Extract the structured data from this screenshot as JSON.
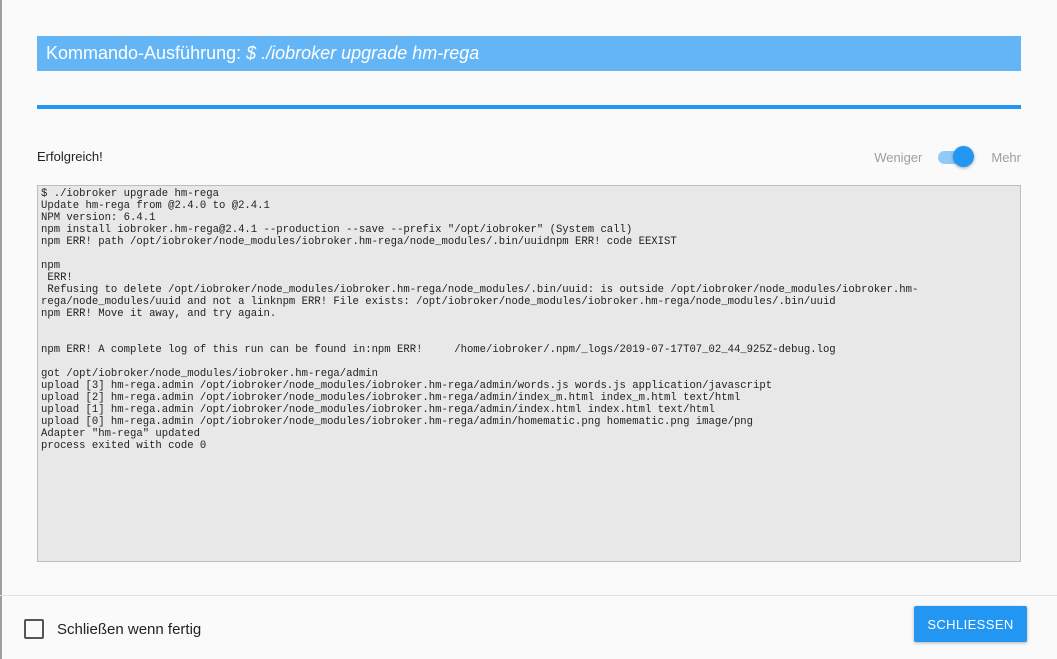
{
  "dialog": {
    "title_prefix": "Kommando-Ausführung: ",
    "title_command": "$ ./iobroker upgrade hm-rega",
    "progress_percent": 100,
    "status": "Erfolgreich!",
    "toggle": {
      "left_label": "Weniger",
      "right_label": "Mehr",
      "state": "on"
    },
    "log_lines": [
      "$ ./iobroker upgrade hm-rega",
      "Update hm-rega from @2.4.0 to @2.4.1",
      "NPM version: 6.4.1",
      "npm install iobroker.hm-rega@2.4.1 --production --save --prefix \"/opt/iobroker\" (System call)",
      "npm ERR! path /opt/iobroker/node_modules/iobroker.hm-rega/node_modules/.bin/uuidnpm ERR! code EEXIST",
      "",
      "npm",
      " ERR!",
      " Refusing to delete /opt/iobroker/node_modules/iobroker.hm-rega/node_modules/.bin/uuid: is outside /opt/iobroker/node_modules/iobroker.hm-",
      "rega/node_modules/uuid and not a linknpm ERR! File exists: /opt/iobroker/node_modules/iobroker.hm-rega/node_modules/.bin/uuid",
      "npm ERR! Move it away, and try again.",
      "",
      "",
      "npm ERR! A complete log of this run can be found in:npm ERR!     /home/iobroker/.npm/_logs/2019-07-17T07_02_44_925Z-debug.log",
      "",
      "got /opt/iobroker/node_modules/iobroker.hm-rega/admin",
      "upload [3] hm-rega.admin /opt/iobroker/node_modules/iobroker.hm-rega/admin/words.js words.js application/javascript",
      "upload [2] hm-rega.admin /opt/iobroker/node_modules/iobroker.hm-rega/admin/index_m.html index_m.html text/html",
      "upload [1] hm-rega.admin /opt/iobroker/node_modules/iobroker.hm-rega/admin/index.html index.html text/html",
      "upload [0] hm-rega.admin /opt/iobroker/node_modules/iobroker.hm-rega/admin/homematic.png homematic.png image/png",
      "Adapter \"hm-rega\" updated",
      "process exited with code 0"
    ],
    "footer": {
      "checkbox_label": "Schließen wenn fertig",
      "checkbox_checked": false,
      "close_button_label": "SCHLIESSEN"
    }
  },
  "colors": {
    "title_background": "#64b5f6",
    "accent": "#2196f3",
    "log_background": "#e8e8e8"
  }
}
